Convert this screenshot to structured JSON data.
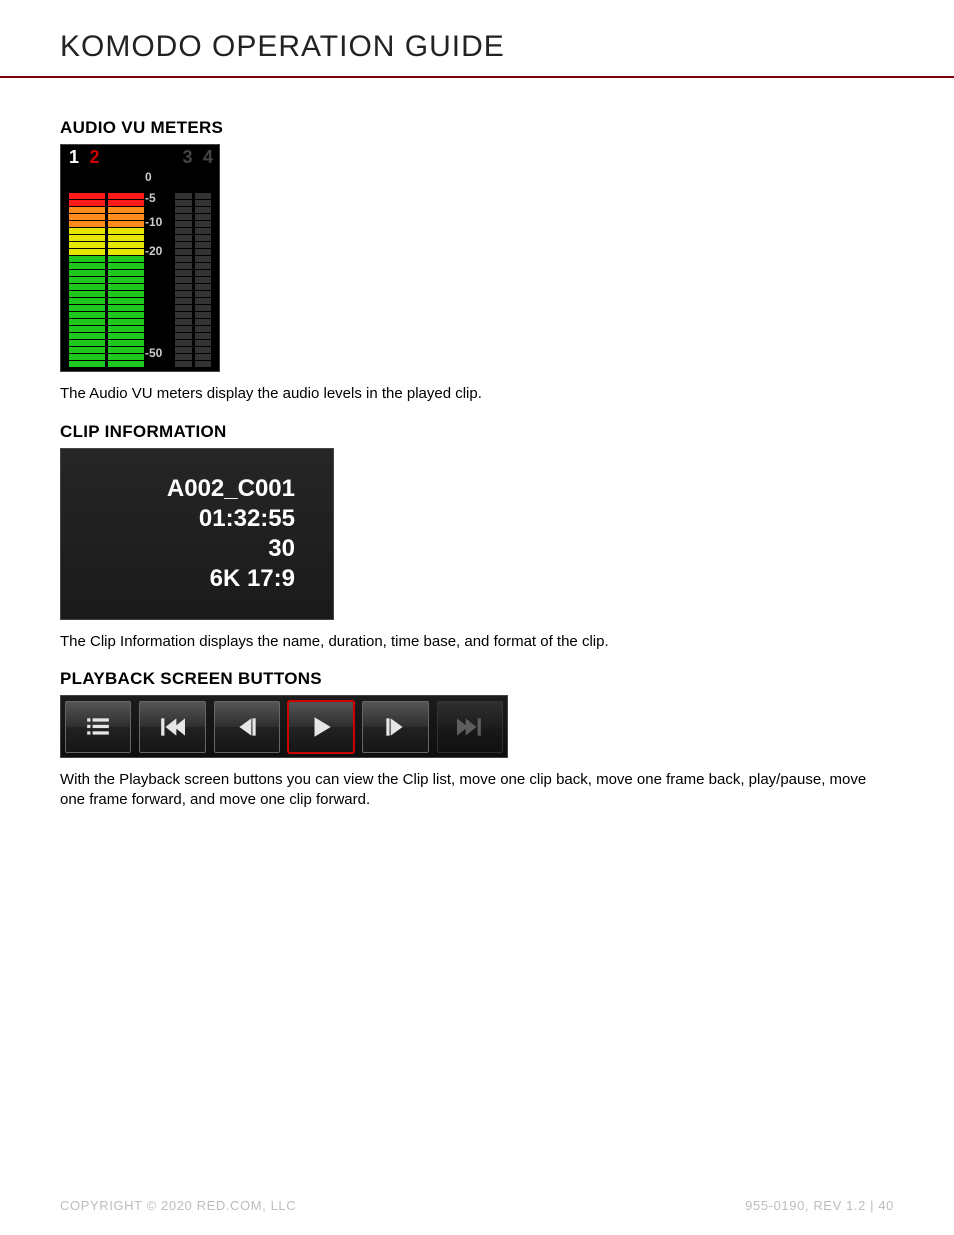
{
  "doc": {
    "title": "KOMODO OPERATION GUIDE"
  },
  "sections": {
    "vu": {
      "heading": "AUDIO VU METERS",
      "body": "The Audio VU meters display the audio levels in the played clip.",
      "channels": {
        "c1": "1",
        "c2": "2",
        "c3": "3",
        "c4": "4"
      },
      "scale": {
        "t0": "0",
        "t1": "-5",
        "t2": "-10",
        "t3": "-20",
        "t4": "-50"
      }
    },
    "clip": {
      "heading": "CLIP INFORMATION",
      "body": "The Clip Information displays the name, duration, time base, and format of the clip.",
      "name": "A002_C001",
      "duration": "01:32:55",
      "timebase": "30",
      "format": "6K 17:9"
    },
    "playback": {
      "heading": "PLAYBACK SCREEN BUTTONS",
      "body": "With the Playback screen buttons you can view the Clip list, move one clip back, move one frame back, play/pause, move one frame forward, and move one clip forward."
    }
  },
  "footer": {
    "copyright": "COPYRIGHT © 2020 RED.COM, LLC",
    "docref": "955-0190, REV 1.2  |  40"
  }
}
